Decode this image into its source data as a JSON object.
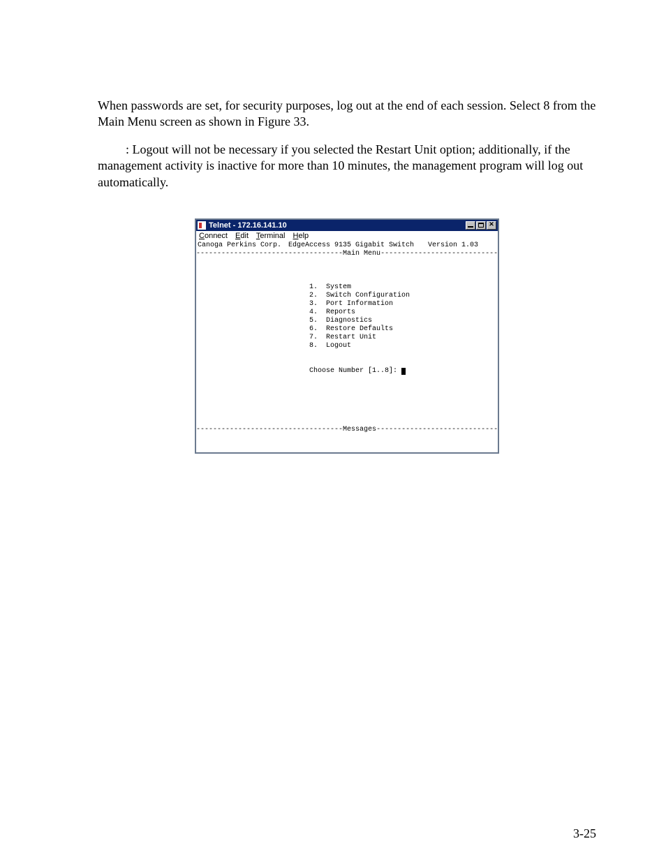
{
  "body": {
    "para1": "When passwords are set, for security purposes, log out at the end of each session. Select 8 from the Main Menu screen as shown in Figure 33.",
    "note": ": Logout will not be necessary if you selected the Restart Unit option; additionally, if the management activity is inactive for more than 10 minutes, the management program will log out automatically."
  },
  "window": {
    "title": "Telnet - 172.16.141.10",
    "menu": {
      "connect": "Connect",
      "edit": "Edit",
      "terminal": "Terminal",
      "help": "Help"
    }
  },
  "terminal": {
    "corp": "Canoga Perkins Corp.",
    "product": "EdgeAccess 9135 Gigabit Switch",
    "version": "Version 1.03",
    "section_main": "Main Menu",
    "menu_items": [
      "1.  System",
      "2.  Switch Configuration",
      "3.  Port Information",
      "4.  Reports",
      "5.  Diagnostics",
      "6.  Restore Defaults",
      "7.  Restart Unit",
      "8.  Logout"
    ],
    "prompt": "Choose Number [1..8]: ",
    "section_messages": "Messages"
  },
  "page_number": "3-25"
}
